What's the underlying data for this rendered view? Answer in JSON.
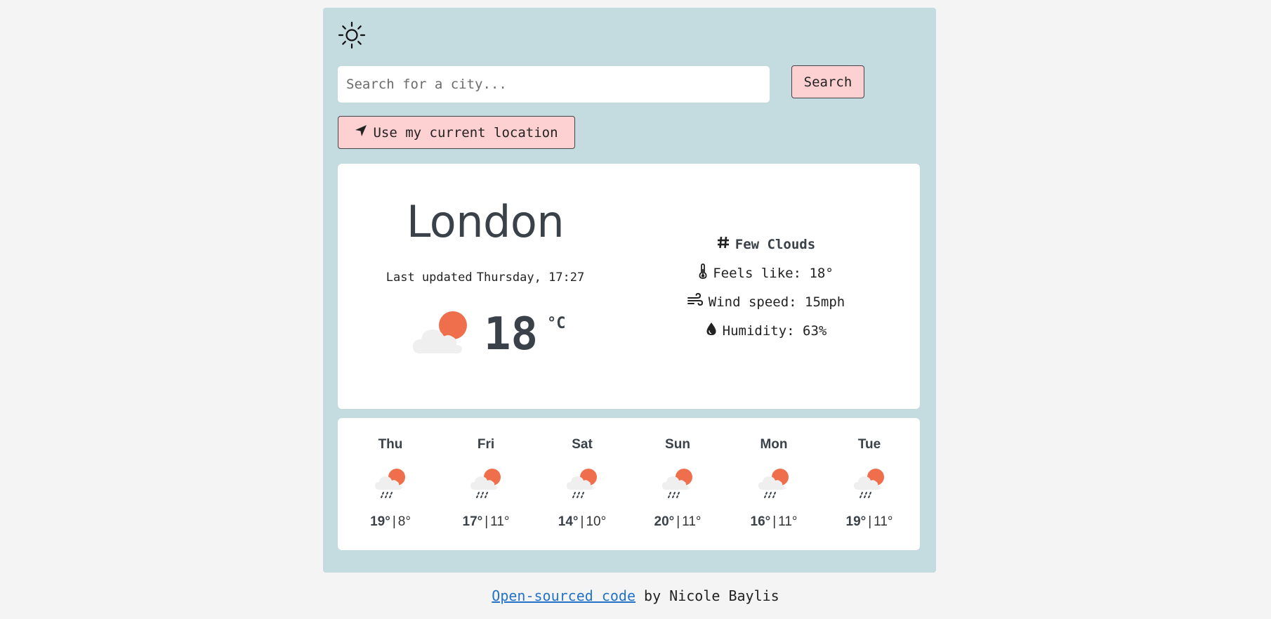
{
  "header": {
    "theme_icon": "sun-icon"
  },
  "search": {
    "placeholder": "Search for a city...",
    "value": "",
    "button_label": "Search"
  },
  "location_button": {
    "icon": "location-arrow-icon",
    "label": "Use my current location"
  },
  "current": {
    "city": "London",
    "updated_prefix": "Last updated",
    "updated_time": "Thursday, 17:27",
    "temperature": "18",
    "unit": "°C",
    "icon": "cloud-sun-icon",
    "description": "Few Clouds",
    "feels_like": "Feels like: 18°",
    "wind": "Wind speed: 15mph",
    "humidity": "Humidity: 63%"
  },
  "forecast": [
    {
      "day": "Thu",
      "high": "19°",
      "low": "8°",
      "icon": "cloud-sun-rain-icon"
    },
    {
      "day": "Fri",
      "high": "17°",
      "low": "11°",
      "icon": "cloud-sun-rain-icon"
    },
    {
      "day": "Sat",
      "high": "14°",
      "low": "10°",
      "icon": "cloud-sun-rain-icon"
    },
    {
      "day": "Sun",
      "high": "20°",
      "low": "11°",
      "icon": "cloud-sun-rain-icon"
    },
    {
      "day": "Mon",
      "high": "16°",
      "low": "11°",
      "icon": "cloud-sun-rain-icon"
    },
    {
      "day": "Tue",
      "high": "19°",
      "low": "11°",
      "icon": "cloud-sun-rain-icon"
    }
  ],
  "footer": {
    "link_text": "Open-sourced code",
    "suffix": "by Nicole Baylis"
  },
  "colors": {
    "app_bg": "#c4dbdf",
    "button_bg": "#fdd0d2",
    "sun": "#ef6f4d",
    "cloud": "#efefef",
    "link": "#2473c7"
  }
}
